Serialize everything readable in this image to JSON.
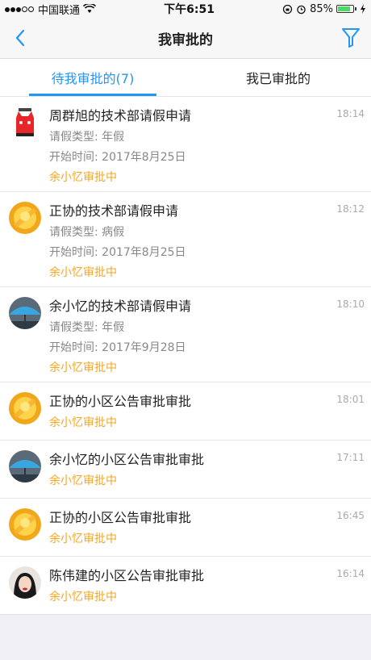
{
  "status_bar": {
    "carrier": "中国联通",
    "time": "下午6:51",
    "battery": "85%",
    "battery_level": 0.85
  },
  "nav": {
    "title": "我审批的",
    "back_icon": "chevron-left-icon",
    "filter_icon": "filter-icon"
  },
  "tabs": [
    {
      "label": "待我审批的(7)",
      "active": true
    },
    {
      "label": "我已审批的",
      "active": false
    }
  ],
  "items": [
    {
      "title": "周群旭的技术部请假申请",
      "time": "18:14",
      "type": "请假类型: 年假",
      "start": "开始时间: 2017年8月25日",
      "status": "余小忆审批中",
      "avatar": "red-cat"
    },
    {
      "title": "正协的技术部请假申请",
      "time": "18:12",
      "type": "请假类型: 病假",
      "start": "开始时间: 2017年8月25日",
      "status": "余小忆审批中",
      "avatar": "yellow"
    },
    {
      "title": "余小忆的技术部请假申请",
      "time": "18:10",
      "type": "请假类型: 年假",
      "start": "开始时间: 2017年9月28日",
      "status": "余小忆审批中",
      "avatar": "umbrella"
    },
    {
      "title": "正协的小区公告审批审批",
      "time": "18:01",
      "status": "余小忆审批中",
      "avatar": "yellow"
    },
    {
      "title": "余小忆的小区公告审批审批",
      "time": "17:11",
      "status": "余小忆审批中",
      "avatar": "umbrella"
    },
    {
      "title": "正协的小区公告审批审批",
      "time": "16:45",
      "status": "余小忆审批中",
      "avatar": "yellow"
    },
    {
      "title": "陈伟建的小区公告审批审批",
      "time": "16:14",
      "status": "余小忆审批中",
      "avatar": "woman"
    }
  ]
}
